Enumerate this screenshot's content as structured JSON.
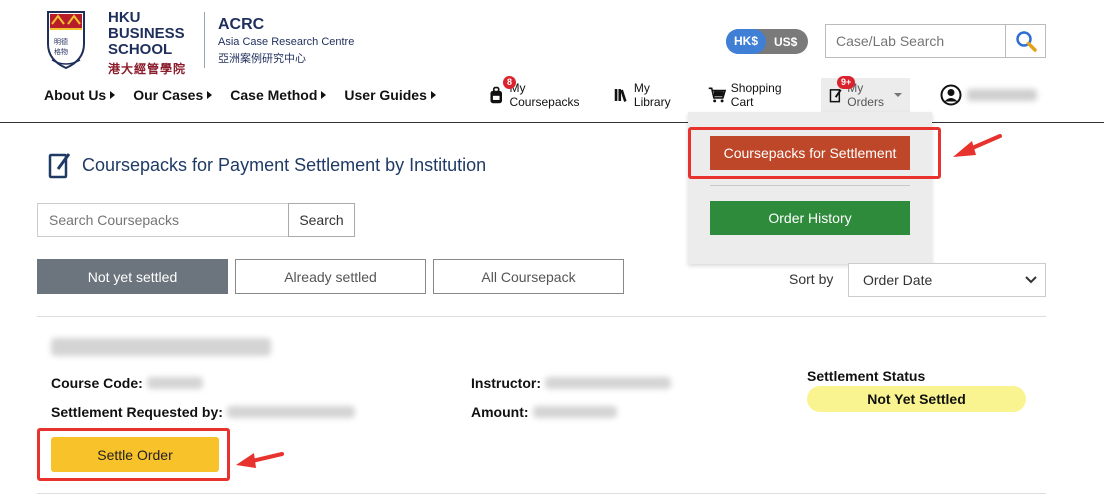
{
  "brand": {
    "hku_line1": "HKU",
    "hku_line2": "BUSINESS",
    "hku_line3": "SCHOOL",
    "hku_chinese": "港大經管學院",
    "acrc_title": "ACRC",
    "acrc_subtitle": "Asia Case Research Centre",
    "acrc_chinese": "亞洲案例研究中心"
  },
  "currency": {
    "hkd": "HK$",
    "usd": "US$",
    "selected": "HK$"
  },
  "search": {
    "placeholder": "Case/Lab Search"
  },
  "nav": [
    {
      "label": "About Us"
    },
    {
      "label": "Our Cases"
    },
    {
      "label": "Case Method"
    },
    {
      "label": "User Guides"
    }
  ],
  "top_links": {
    "coursepacks": {
      "label": "My Coursepacks",
      "badge": "8"
    },
    "library": {
      "label": "My Library"
    },
    "cart": {
      "label": "Shopping Cart"
    },
    "orders": {
      "label": "My Orders",
      "badge": "9+"
    }
  },
  "dropdown": {
    "settlement_label": "Coursepacks for Settlement",
    "history_label": "Order History"
  },
  "page": {
    "title": "Coursepacks for Payment Settlement by Institution",
    "search_placeholder": "Search Coursepacks",
    "search_button": "Search",
    "tabs": [
      {
        "label": "Not yet settled",
        "active": true
      },
      {
        "label": "Already settled",
        "active": false
      },
      {
        "label": "All Coursepack",
        "active": false
      }
    ],
    "sort_label": "Sort by",
    "sort_value": "Order Date"
  },
  "card": {
    "course_code_label": "Course Code:",
    "settlement_requested_label": "Settlement Requested by:",
    "instructor_label": "Instructor:",
    "amount_label": "Amount:",
    "status_label": "Settlement Status",
    "status_value": "Not Yet Settled",
    "settle_button": "Settle Order"
  },
  "colors": {
    "brand_navy": "#1f2f5c",
    "settle_dropdown": "#bd4728",
    "history_button": "#2e8b3c",
    "settle_button": "#f8c22a",
    "status_badge": "#f9f48f",
    "annotation_red": "#e8322d"
  }
}
